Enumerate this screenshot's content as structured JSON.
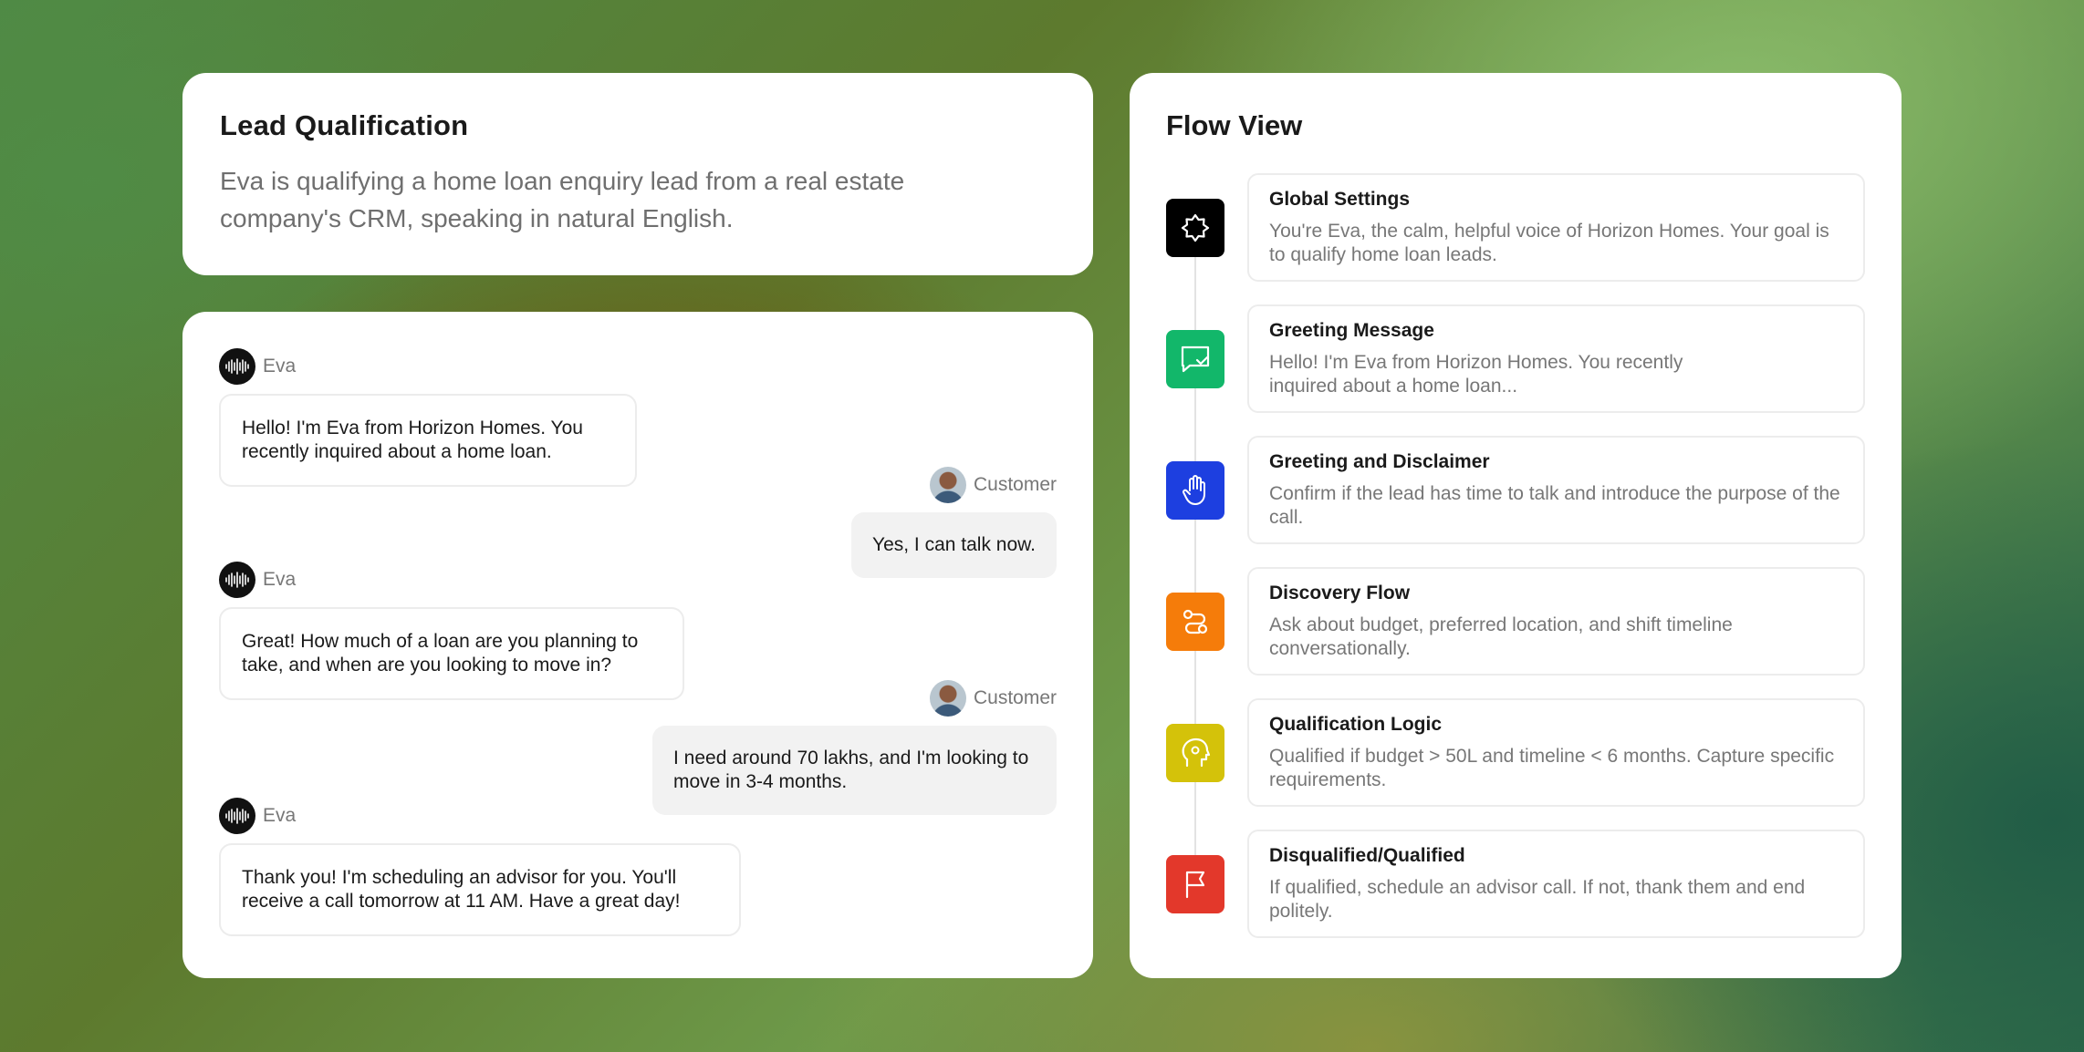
{
  "lead": {
    "title": "Lead Qualification",
    "description": "Eva is qualifying a home loan enquiry lead from a real estate company's CRM, speaking in natural English."
  },
  "chat": {
    "messages": [
      {
        "speaker": "Eva",
        "text": "Hello! I'm Eva from Horizon Homes. You recently inquired about a home loan."
      },
      {
        "speaker": "Customer",
        "text": "Yes, I can talk now."
      },
      {
        "speaker": "Eva",
        "text": "Great! How much of a loan are you planning to take, and when are you looking to move in?"
      },
      {
        "speaker": "Customer",
        "text": "I need around 70 lakhs, and I'm looking to move in 3-4 months."
      },
      {
        "speaker": "Eva",
        "text": "Thank you! I'm scheduling an advisor for you. You'll receive a call tomorrow at 11 AM. Have a great day!"
      }
    ]
  },
  "flow": {
    "title": "Flow View",
    "steps": [
      {
        "title": "Global Settings",
        "desc": "You're Eva, the calm, helpful voice of Horizon Homes. Your goal is to qualify home loan leads.",
        "icon": "settings-gear-icon",
        "color": "#000000"
      },
      {
        "title": "Greeting Message",
        "desc": "Hello! I'm Eva from Horizon Homes. You recently inquired about a home loan...",
        "icon": "message-check-icon",
        "color": "#12b76a"
      },
      {
        "title": "Greeting and Disclaimer",
        "desc": "Confirm if the lead has time to talk and introduce the purpose of the call.",
        "icon": "hand-icon",
        "color": "#1d3fe0"
      },
      {
        "title": "Discovery Flow",
        "desc": "Ask about budget, preferred location, and shift timeline conversationally.",
        "icon": "route-icon",
        "color": "#f57c0a"
      },
      {
        "title": "Qualification Logic",
        "desc": "Qualified if budget > 50L and timeline < 6 months. Capture specific requirements.",
        "icon": "head-gear-icon",
        "color": "#d4c20a"
      },
      {
        "title": "Disqualified/Qualified",
        "desc": "If qualified, schedule an advisor call. If not, thank them and end politely.",
        "icon": "flag-icon",
        "color": "#e3382b"
      }
    ]
  }
}
